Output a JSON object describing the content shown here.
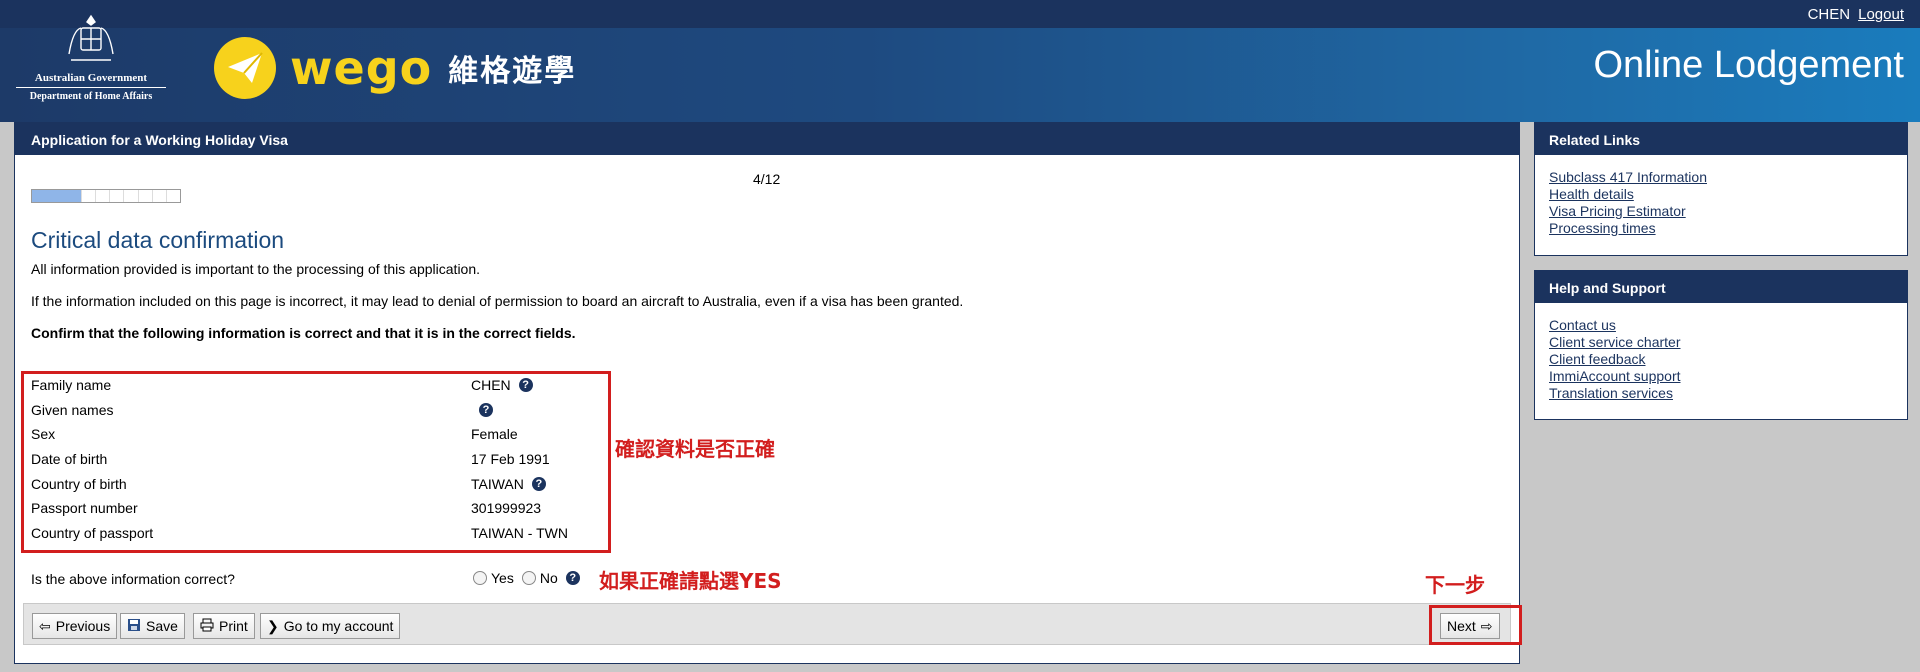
{
  "header": {
    "gov_line1": "Australian Government",
    "gov_line2": "Department of Home Affairs",
    "brand_word": "wego",
    "brand_cn": "維格遊學",
    "site_title": "Online Lodgement",
    "user_name": "CHEN",
    "logout_label": "Logout"
  },
  "main": {
    "panel_title": "Application for a Working Holiday Visa",
    "step": "4/12",
    "progress_fraction": 0.33,
    "page_title": "Critical data confirmation",
    "intro1": "All information provided is important to the processing of this application.",
    "intro2": "If the information included on this page is incorrect, it may lead to denial of permission to board an aircraft to Australia, even if a visa has been granted.",
    "intro3": "Confirm that the following information is correct and that it is in the correct fields.",
    "fields": [
      {
        "label": "Family name",
        "value": "CHEN"
      },
      {
        "label": "Given names",
        "value": ""
      },
      {
        "label": "Sex",
        "value": "Female"
      },
      {
        "label": "Date of birth",
        "value": "17 Feb 1991"
      },
      {
        "label": "Country of birth",
        "value": "TAIWAN"
      },
      {
        "label": "Passport number",
        "value": "301999923"
      },
      {
        "label": "Country of passport",
        "value": "TAIWAN - TWN"
      }
    ],
    "question": "Is the above information correct?",
    "yes_label": "Yes",
    "no_label": "No",
    "help_glyph": "?",
    "annotations": {
      "confirm_data": "確認資料是否正確",
      "select_yes": "如果正確請點選YES",
      "next_step": "下一步"
    }
  },
  "toolbar": {
    "previous_label": "Previous",
    "save_label": "Save",
    "print_label": "Print",
    "account_label": "Go to my account",
    "next_label": "Next"
  },
  "sidebar": {
    "related_title": "Related Links",
    "related_links": [
      "Subclass 417 Information",
      "Health details",
      "Visa Pricing Estimator",
      "Processing times"
    ],
    "help_title": "Help and Support",
    "help_links": [
      "Contact us",
      "Client service charter",
      "Client feedback",
      "ImmiAccount support",
      "Translation services"
    ]
  },
  "colors": {
    "navy": "#1b335e",
    "annotation_red": "#d21e1e",
    "wego_yellow": "#f7d21c",
    "progress_fill": "#8fb5e8"
  }
}
